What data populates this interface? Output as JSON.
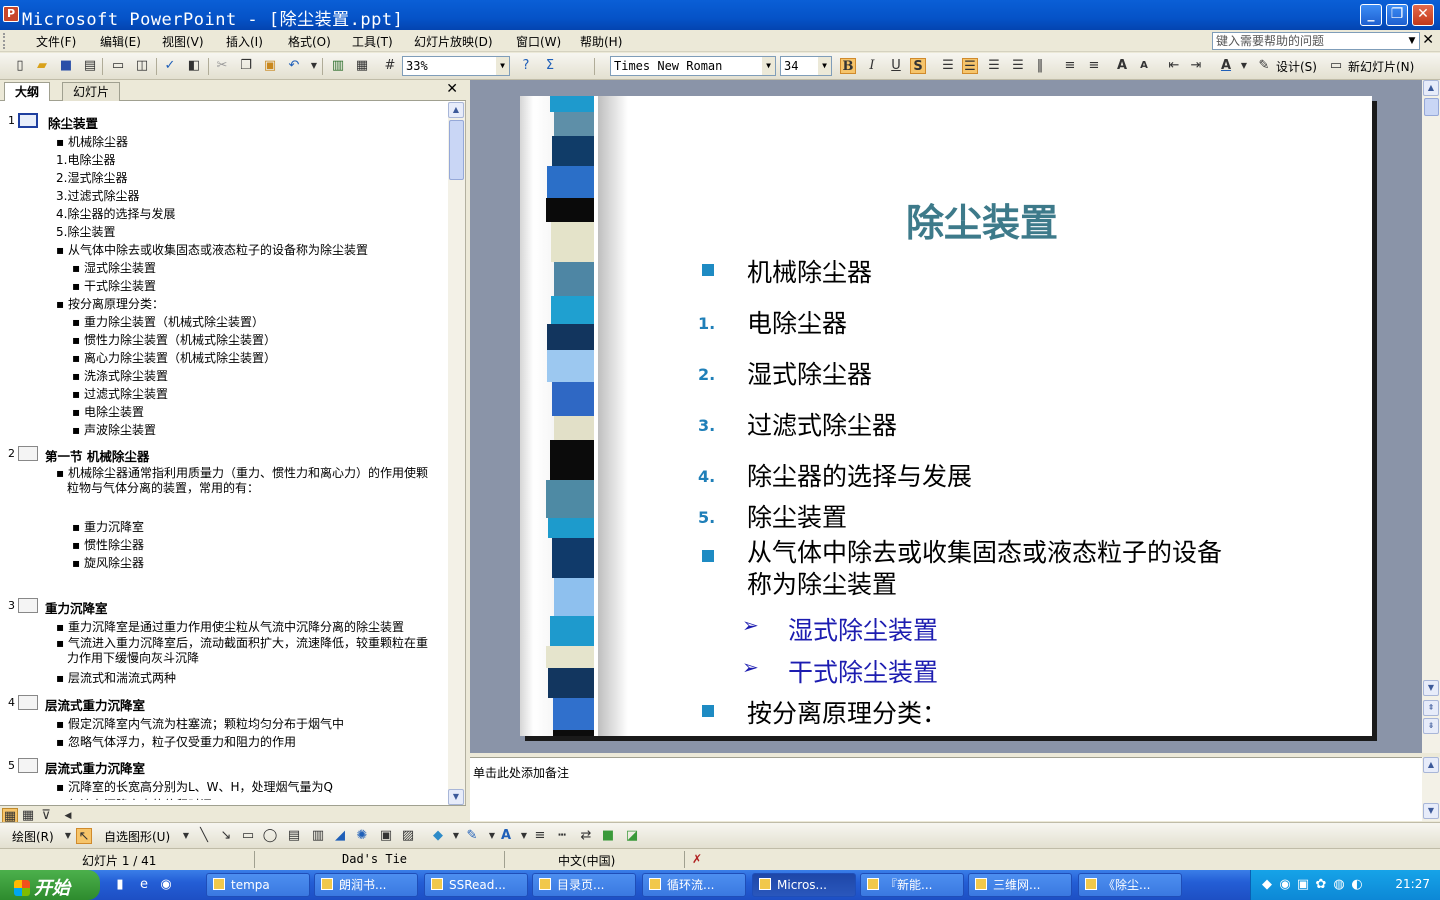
{
  "window": {
    "title": "Microsoft PowerPoint - [除尘装置.ppt]",
    "buttons": {
      "minimize": "_",
      "restore": "❐",
      "close": "✕"
    }
  },
  "menu": {
    "items": [
      "文件(F)",
      "编辑(E)",
      "视图(V)",
      "插入(I)",
      "格式(O)",
      "工具(T)",
      "幻灯片放映(D)",
      "窗口(W)",
      "帮助(H)"
    ],
    "help_placeholder": "键入需要帮助的问题"
  },
  "toolbar": {
    "zoom": "33%",
    "font": "Times New Roman",
    "size": "34",
    "bold": "B",
    "italic": "I",
    "underline": "U",
    "shadow": "S",
    "design": "设计(S)",
    "new_slide": "新幻灯片(N)"
  },
  "left_pane": {
    "tabs": [
      "大纲",
      "幻灯片"
    ],
    "close": "✕",
    "slides": [
      {
        "num": "1",
        "title": "除尘装置",
        "items": [
          {
            "t": "机械除尘器",
            "lvl": 1,
            "bullet": true
          },
          {
            "t": "1.电除尘器",
            "lvl": 1
          },
          {
            "t": "2.湿式除尘器",
            "lvl": 1
          },
          {
            "t": "3.过滤式除尘器",
            "lvl": 1
          },
          {
            "t": "4.除尘器的选择与发展",
            "lvl": 1
          },
          {
            "t": "5.除尘装置",
            "lvl": 1
          },
          {
            "t": "从气体中除去或收集固态或液态粒子的设备称为除尘装置",
            "lvl": 1,
            "bullet": true
          },
          {
            "t": "湿式除尘装置",
            "lvl": 2,
            "bullet": true
          },
          {
            "t": "干式除尘装置",
            "lvl": 2,
            "bullet": true
          },
          {
            "t": "按分离原理分类：",
            "lvl": 1,
            "bullet": true
          },
          {
            "t": "重力除尘装置（机械式除尘装置）",
            "lvl": 2,
            "bullet": true
          },
          {
            "t": "惯性力除尘装置（机械式除尘装置）",
            "lvl": 2,
            "bullet": true
          },
          {
            "t": "离心力除尘装置（机械式除尘装置）",
            "lvl": 2,
            "bullet": true
          },
          {
            "t": "洗涤式除尘装置",
            "lvl": 2,
            "bullet": true
          },
          {
            "t": "过滤式除尘装置",
            "lvl": 2,
            "bullet": true
          },
          {
            "t": "电除尘装置",
            "lvl": 2,
            "bullet": true
          },
          {
            "t": "声波除尘装置",
            "lvl": 2,
            "bullet": true
          }
        ]
      },
      {
        "num": "2",
        "title": "第一节  机械除尘器",
        "items": [
          {
            "t": "机械除尘器通常指利用质量力（重力、惯性力和离心力）的作用使颗粒物与气体分离的装置，常用的有：",
            "lvl": 1,
            "bullet": true,
            "wrap": true
          },
          {
            "t": "重力沉降室",
            "lvl": 2,
            "bullet": true
          },
          {
            "t": "惯性除尘器",
            "lvl": 2,
            "bullet": true
          },
          {
            "t": "旋风除尘器",
            "lvl": 2,
            "bullet": true
          }
        ]
      },
      {
        "num": "3",
        "title": "重力沉降室",
        "items": [
          {
            "t": "重力沉降室是通过重力作用使尘粒从气流中沉降分离的除尘装置",
            "lvl": 1,
            "bullet": true
          },
          {
            "t": "气流进入重力沉降室后，流动截面积扩大，流速降低，较重颗粒在重力作用下缓慢向灰斗沉降",
            "lvl": 1,
            "bullet": true,
            "wrap": true
          },
          {
            "t": "层流式和湍流式两种",
            "lvl": 1,
            "bullet": true
          }
        ]
      },
      {
        "num": "4",
        "title": "层流式重力沉降室",
        "items": [
          {
            "t": "假定沉降室内气流为柱塞流；颗粒均匀分布于烟气中",
            "lvl": 1,
            "bullet": true
          },
          {
            "t": "忽略气体浮力，粒子仅受重力和阻力的作用",
            "lvl": 1,
            "bullet": true
          }
        ]
      },
      {
        "num": "5",
        "title": "层流式重力沉降室",
        "items": [
          {
            "t": "沉降室的长宽高分别为L、W、H，处理烟气量为Q",
            "lvl": 1,
            "bullet": true
          },
          {
            "t": "气流在沉降室内的停留时间",
            "lvl": 1,
            "bullet": true
          }
        ]
      }
    ]
  },
  "slide": {
    "title": "除尘装置",
    "bullets": [
      {
        "marker": "■",
        "text": "机械除尘器"
      },
      {
        "marker": "1.",
        "text": "电除尘器"
      },
      {
        "marker": "2.",
        "text": "湿式除尘器"
      },
      {
        "marker": "3.",
        "text": "过滤式除尘器"
      },
      {
        "marker": "4.",
        "text": "除尘器的选择与发展"
      },
      {
        "marker": "5.",
        "text": "除尘装置"
      },
      {
        "marker": "■",
        "text": "从气体中除去或收集固态或液态粒子的设备称为除尘装置"
      },
      {
        "marker": "➢",
        "text": "湿式除尘装置"
      },
      {
        "marker": "➢",
        "text": "干式除尘装置"
      },
      {
        "marker": "■",
        "text": "按分离原理分类："
      },
      {
        "marker": "➢",
        "text": "重力除尘装置（机械式除尘装置）"
      }
    ]
  },
  "notes": {
    "placeholder": "单击此处添加备注"
  },
  "drawbar": {
    "draw": "绘图(R)",
    "autoshapes": "自选图形(U)"
  },
  "status": {
    "slide": "幻灯片 1 / 41",
    "design": "Dad's Tie",
    "language": "中文(中国)"
  },
  "taskbar": {
    "start": "开始",
    "buttons": [
      "tempa",
      "朗润书...",
      "SSRead...",
      "目录页...",
      "循环流...",
      "Micros...",
      "『新能...",
      "三维网...",
      "《除尘..."
    ],
    "clock": "21:27"
  },
  "colors": {
    "title_teal": "#3D7A8A",
    "bullet_blue": "#1E8BC3",
    "sub_blue": "#1C1CB0",
    "xp_blue": "#245ED6"
  }
}
